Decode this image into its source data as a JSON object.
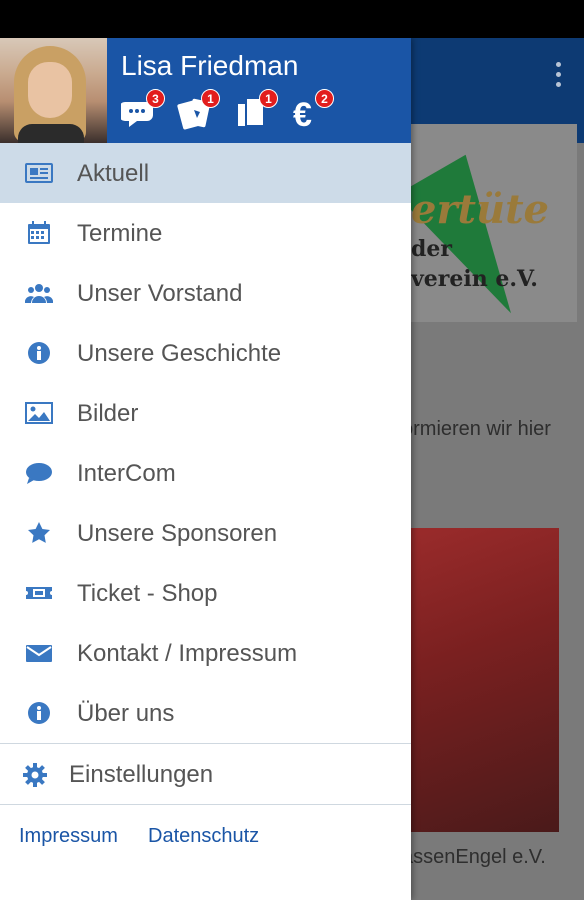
{
  "user": {
    "name": "Lisa Friedman"
  },
  "header_icons": [
    {
      "icon": "chat-icon",
      "badge": "3"
    },
    {
      "icon": "tickets-icon",
      "badge": "1"
    },
    {
      "icon": "documents-icon",
      "badge": "1"
    },
    {
      "icon": "euro-icon",
      "badge": "2"
    }
  ],
  "menu": {
    "items": [
      {
        "label": "Aktuell",
        "icon": "newspaper-icon",
        "active": true
      },
      {
        "label": "Termine",
        "icon": "calendar-icon"
      },
      {
        "label": "Unser Vorstand",
        "icon": "group-icon"
      },
      {
        "label": "Unsere Geschichte",
        "icon": "info-icon"
      },
      {
        "label": "Bilder",
        "icon": "image-icon"
      },
      {
        "label": "InterCom",
        "icon": "chat-bubble-icon"
      },
      {
        "label": "Unsere Sponsoren",
        "icon": "star-icon"
      },
      {
        "label": "Ticket - Shop",
        "icon": "ticket-icon"
      },
      {
        "label": "Kontakt / Impressum",
        "icon": "envelope-icon"
      },
      {
        "label": "Über uns",
        "icon": "info-icon"
      }
    ],
    "settings_label": "Einstellungen",
    "footer": {
      "impressum": "Impressum",
      "datenschutz": "Datenschutz"
    }
  },
  "background": {
    "banner_line1": "ertüte",
    "banner_line2": "der",
    "banner_line3": "verein  e.V.",
    "text_snippet": "ormieren wir hier",
    "caption": "assenEngel e.V."
  },
  "colors": {
    "header_blue": "#1a55a6",
    "accent": "#3a78c2",
    "active_bg": "#cddbe8",
    "badge_red": "#e21d1d"
  }
}
